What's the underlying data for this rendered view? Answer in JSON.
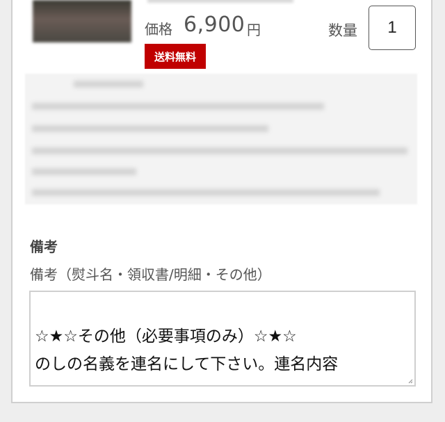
{
  "product": {
    "price_label": "価格",
    "price_value": "6,900",
    "price_unit": "円",
    "shipping_badge": "送料無料",
    "quantity_label": "数量",
    "quantity_value": "1"
  },
  "notes": {
    "heading": "備考",
    "subheading": "備考（熨斗名・領収書/明細・その他）",
    "lines": [
      "",
      "☆★☆その他（必要事項のみ）☆★☆",
      "のしの名義を連名にして下さい。連名内容"
    ]
  },
  "colors": {
    "badge_bg": "#c00000",
    "page_bg": "#eeeeee",
    "border": "#cfcfcf"
  }
}
